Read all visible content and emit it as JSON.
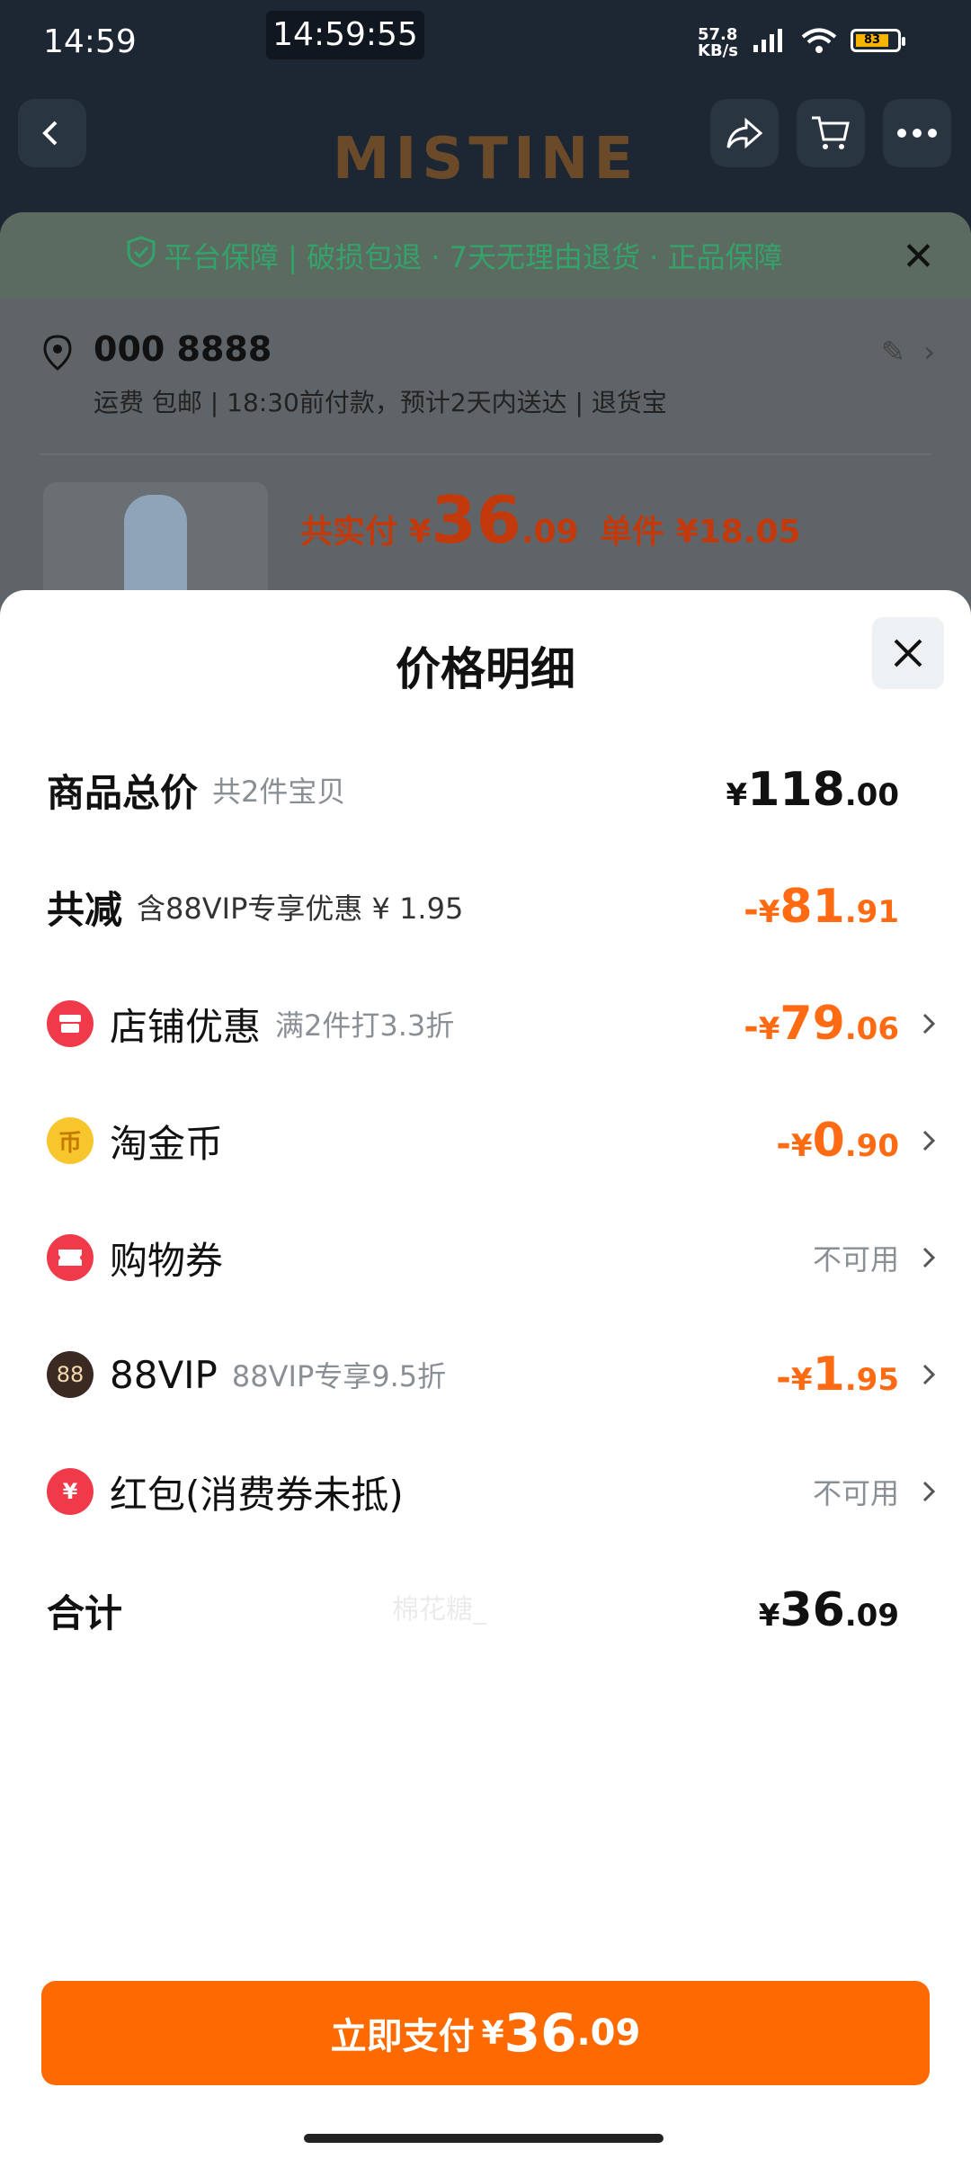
{
  "status": {
    "time": "14:59",
    "center_clock": "14:59:55",
    "net_speed_value": "57.8",
    "net_speed_unit": "KB/s",
    "battery": "83"
  },
  "background": {
    "brand": "MISTINE",
    "guarantee": "平台保障 | 破损包退 · 7天无理由退货 · 正品保障",
    "address_name": "000 8888",
    "address_sub": "运费 包邮 | 18:30前付款，预计2天内送达 | 退货宝",
    "pay_label": "共实付 ¥",
    "pay_int": "36",
    "pay_dec": ".09",
    "unit_price": "单件 ¥18.05"
  },
  "sheet": {
    "title": "价格明细",
    "rows": [
      {
        "label": "商品总价",
        "sub": "共2件宝贝",
        "currency": "¥",
        "int": "118",
        "dec": ".00"
      },
      {
        "label": "共减",
        "sub": "含88VIP专享优惠 ¥ 1.95",
        "sign": "-",
        "currency": "¥",
        "int": "81",
        "dec": ".91"
      },
      {
        "label": "店铺优惠",
        "sub": "满2件打3.3折",
        "sign": "-",
        "currency": "¥",
        "int": "79",
        "dec": ".06"
      },
      {
        "label": "淘金币",
        "sub": "",
        "sign": "-",
        "currency": "¥",
        "int": "0",
        "dec": ".90"
      },
      {
        "label": "购物券",
        "sub": "",
        "value_text": "不可用"
      },
      {
        "label": "88VIP",
        "sub": "88VIP专享9.5折",
        "sign": "-",
        "currency": "¥",
        "int": "1",
        "dec": ".95"
      },
      {
        "label": "红包(消费券未抵)",
        "sub": "",
        "value_text": "不可用"
      },
      {
        "label": "合计",
        "sub": "",
        "currency": "¥",
        "int": "36",
        "dec": ".09"
      }
    ],
    "icon_glyphs": {
      "coin": "币",
      "vip": "88",
      "hongbao": "¥"
    },
    "watermark": "棉花糖_"
  },
  "pay_button": {
    "label": "立即支付",
    "currency": "¥",
    "int": "36",
    "dec": ".09"
  },
  "colors": {
    "accent": "#ff6a00",
    "discount": "#ff6a13",
    "shop_red": "#f03a4a",
    "coin_gold": "#f7c52c"
  }
}
